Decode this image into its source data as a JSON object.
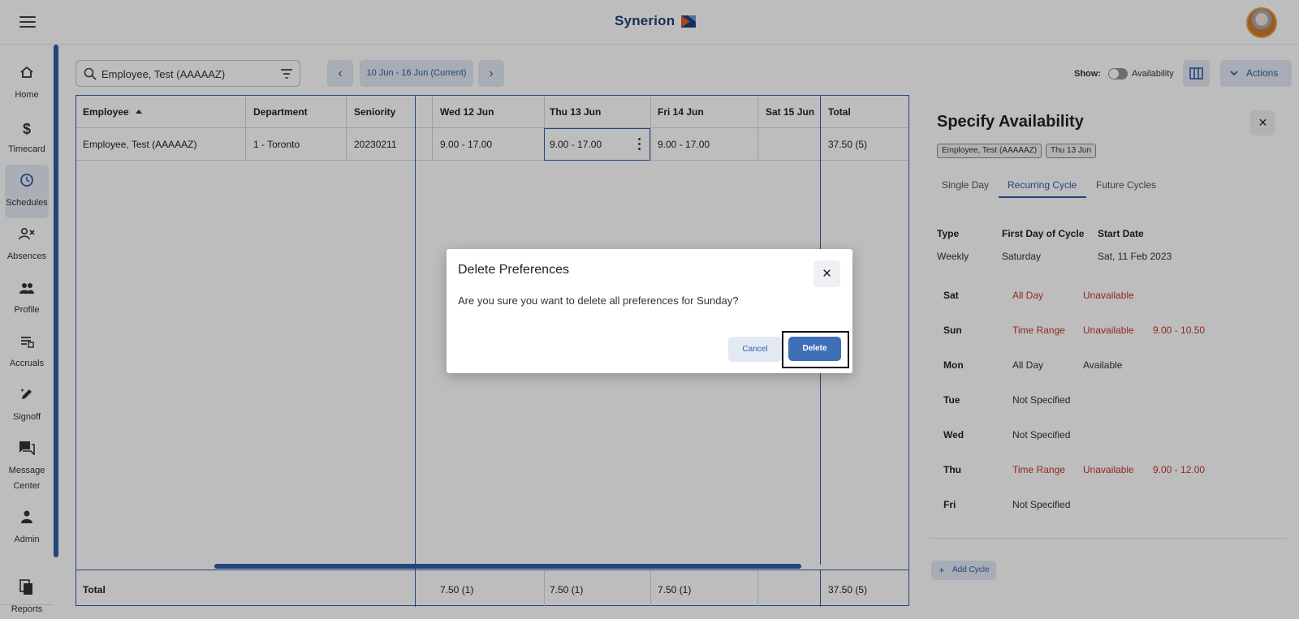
{
  "app": {
    "brand": "Synerion"
  },
  "nav": {
    "items": [
      {
        "label": "Home",
        "icon": "home-icon"
      },
      {
        "label": "Timecard",
        "icon": "dollar-icon"
      },
      {
        "label": "Schedules",
        "icon": "clock-icon"
      },
      {
        "label": "Absences",
        "icon": "person-x-icon"
      },
      {
        "label": "Profile",
        "icon": "people-icon"
      },
      {
        "label": "Accruals",
        "icon": "list-icon"
      },
      {
        "label": "Signoff",
        "icon": "pen-icon"
      },
      {
        "label": "Message",
        "label2": "Center",
        "icon": "chat-icon"
      },
      {
        "label": "Admin",
        "icon": "person-icon"
      },
      {
        "label": "Reports",
        "icon": "reports-icon"
      }
    ],
    "active": "Schedules"
  },
  "toolbar": {
    "search_value": "Employee, Test (AAAAAZ)",
    "date_range": "10 Jun - 16 Jun (Current)",
    "show_label": "Show:",
    "availability_label": "Availability",
    "availability_on": false,
    "actions_label": "Actions"
  },
  "grid": {
    "headers": [
      "Employee",
      "Department",
      "Seniority",
      "Wed 12 Jun",
      "Thu 13 Jun",
      "Fri 14 Jun",
      "Sat 15 Jun",
      "Total"
    ],
    "row": [
      "Employee, Test (AAAAAZ)",
      "1 - Toronto",
      "20230211",
      "9.00 - 17.00",
      "9.00 - 17.00",
      "9.00 - 17.00",
      "",
      "37.50 (5)"
    ],
    "total_label": "Total",
    "totals": [
      "7.50 (1)",
      "7.50 (1)",
      "7.50 (1)",
      "",
      "37.50 (5)"
    ]
  },
  "panel": {
    "title": "Specify Availability",
    "chips": [
      "Employee, Test (AAAAAZ)",
      "Thu 13 Jun"
    ],
    "tabs": [
      "Single Day",
      "Recurring Cycle",
      "Future Cycles"
    ],
    "active_tab": "Recurring Cycle",
    "info_headers": [
      "Type",
      "First Day of Cycle",
      "Start Date"
    ],
    "info_values": [
      "Weekly",
      "Saturday",
      "Sat, 11 Feb 2023"
    ],
    "days": [
      {
        "day": "Sat",
        "mode": "All Day",
        "status": "Unavailable",
        "range": ""
      },
      {
        "day": "Sun",
        "mode": "Time Range",
        "status": "Unavailable",
        "range": "9.00 - 10.50"
      },
      {
        "day": "Mon",
        "mode": "All Day",
        "status": "Available",
        "range": ""
      },
      {
        "day": "Tue",
        "mode": "Not Specified",
        "status": "",
        "range": ""
      },
      {
        "day": "Wed",
        "mode": "Not Specified",
        "status": "",
        "range": ""
      },
      {
        "day": "Thu",
        "mode": "Time Range",
        "status": "Unavailable",
        "range": "9.00 - 12.00"
      },
      {
        "day": "Fri",
        "mode": "Not Specified",
        "status": "",
        "range": ""
      }
    ],
    "add_cycle": "Add Cycle"
  },
  "modal": {
    "title": "Delete Preferences",
    "body": "Are you sure you want to delete all preferences for Sunday?",
    "cancel_label": "Cancel",
    "delete_label": "Delete"
  },
  "colors": {
    "accent": "#2f5ea6",
    "primary_button": "#3f6fb9",
    "unavailable": "#c0392b",
    "light_button": "#e3e9f3"
  }
}
